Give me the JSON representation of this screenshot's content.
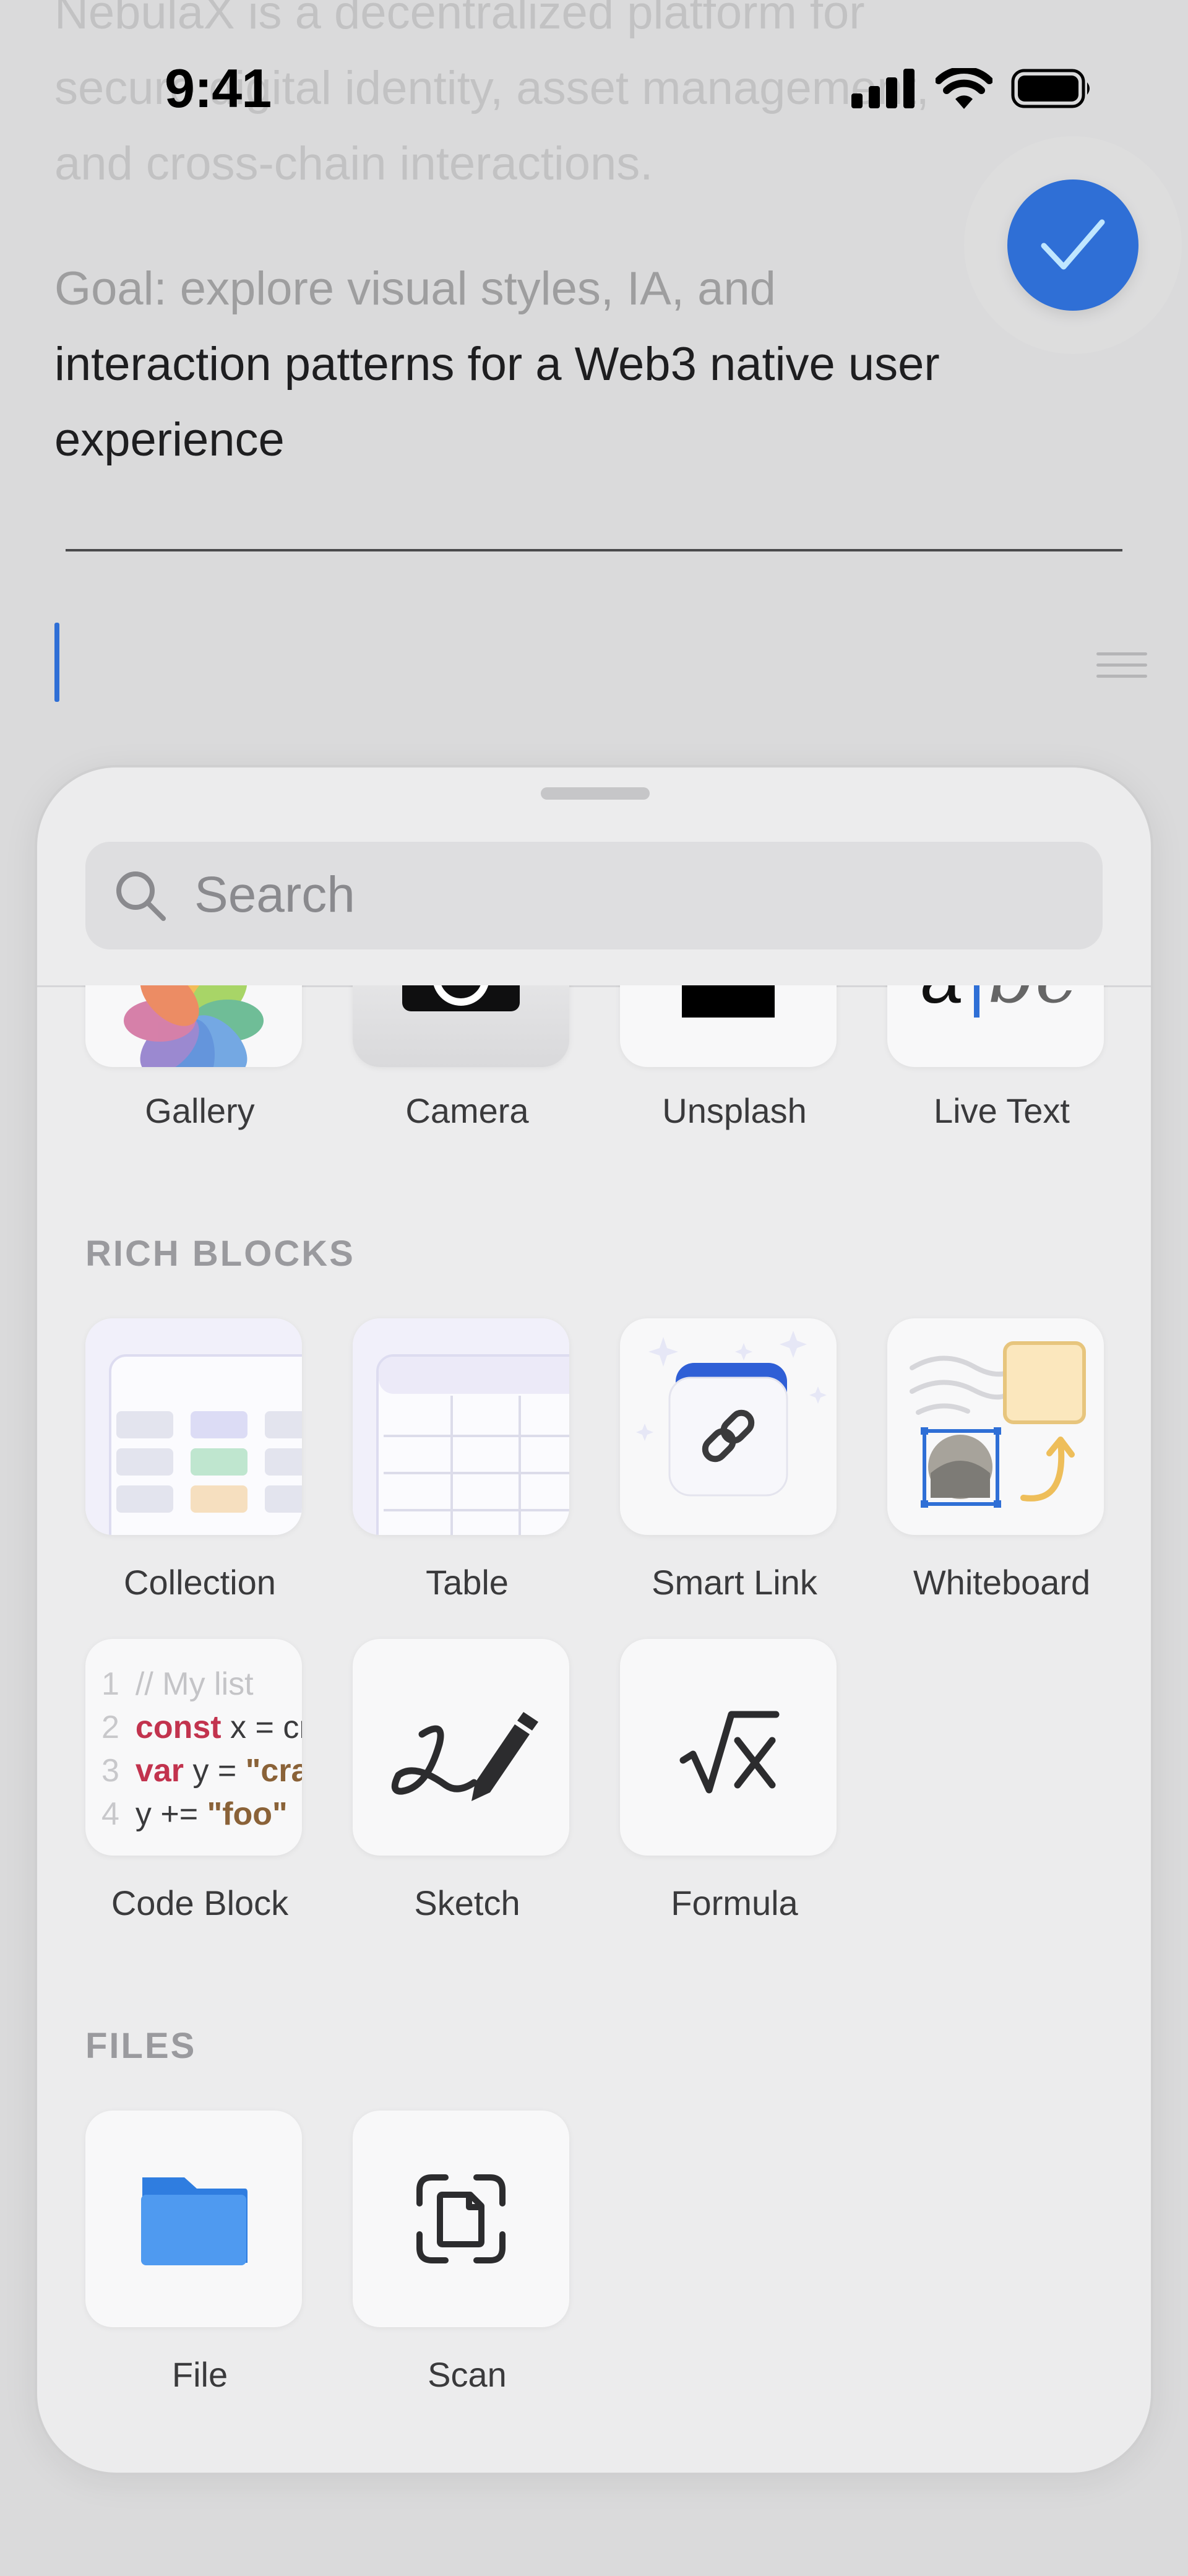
{
  "status_bar": {
    "time": "9:41"
  },
  "document": {
    "faded_lines": [
      "NebulaX is a decentralized platform for",
      "secure digital identity, asset management,",
      "and cross-chain interactions."
    ],
    "goal_line_faded": "Goal: explore visual styles, IA, and",
    "goal_lines": [
      "interaction patterns for a Web3 native user",
      "experience"
    ]
  },
  "search": {
    "placeholder": "Search"
  },
  "media": {
    "items": [
      {
        "label": "Gallery",
        "icon": "photos-icon"
      },
      {
        "label": "Camera",
        "icon": "camera-icon"
      },
      {
        "label": "Unsplash",
        "icon": "unsplash-icon"
      },
      {
        "label": "Live Text",
        "icon": "live-text-icon"
      }
    ],
    "live_text_glyphs": [
      "a",
      "bc"
    ]
  },
  "rich_blocks": {
    "title": "RICH BLOCKS",
    "items": [
      {
        "label": "Collection",
        "icon": "collection-icon"
      },
      {
        "label": "Table",
        "icon": "table-icon"
      },
      {
        "label": "Smart Link",
        "icon": "link-icon"
      },
      {
        "label": "Whiteboard",
        "icon": "whiteboard-icon"
      },
      {
        "label": "Code Block",
        "icon": "code-icon"
      },
      {
        "label": "Sketch",
        "icon": "pen-icon"
      },
      {
        "label": "Formula",
        "icon": "sqrt-icon"
      }
    ],
    "code_preview": [
      {
        "n": "1",
        "parts": [
          {
            "t": "// My list",
            "c": "cmt"
          }
        ]
      },
      {
        "n": "2",
        "parts": [
          {
            "t": "const",
            "c": "kw"
          },
          {
            "t": " x = cr",
            "c": "plain"
          }
        ]
      },
      {
        "n": "3",
        "parts": [
          {
            "t": "var",
            "c": "kw"
          },
          {
            "t": " y = ",
            "c": "plain"
          },
          {
            "t": "\"craf",
            "c": "str"
          }
        ]
      },
      {
        "n": "4",
        "parts": [
          {
            "t": "y += ",
            "c": "plain"
          },
          {
            "t": "\"foo\"",
            "c": "str"
          }
        ]
      }
    ]
  },
  "files": {
    "title": "FILES",
    "items": [
      {
        "label": "File",
        "icon": "folder-icon"
      },
      {
        "label": "Scan",
        "icon": "scan-document-icon"
      }
    ]
  },
  "colors": {
    "accent": "#2F6FD6",
    "sheet": "#ECECED",
    "tile": "#F8F8F9"
  }
}
